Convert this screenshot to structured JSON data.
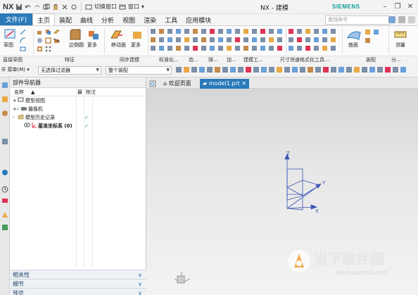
{
  "app": {
    "logo": "NX",
    "window_title": "NX - 建模",
    "brand": "SIEMENS"
  },
  "quick_access": {
    "switch_window": "切换窗口",
    "window": "窗口"
  },
  "search": {
    "placeholder": "查找命令"
  },
  "menu": {
    "file": "文件(F)",
    "tabs": [
      "主页",
      "装配",
      "曲线",
      "分析",
      "视图",
      "渲染",
      "工具",
      "应用模块"
    ],
    "active_tab": "主页"
  },
  "ribbon": {
    "sketch": "草图",
    "edge_blend": "边倒圆",
    "more": "更多",
    "move_face": "移动面",
    "more2": "更多",
    "surface": "曲面",
    "measure": "测量",
    "group_labels": [
      "直接草图",
      "特征",
      "同步建模",
      "标准化...",
      "齿...",
      "弹...",
      "加...",
      "建模工...",
      "尺寸快速格式化工具...",
      "装配",
      "分..."
    ]
  },
  "command_bar": {
    "menu": "菜单(M)",
    "filter": "无选择过滤器",
    "scope": "整个装配"
  },
  "navigator": {
    "title": "部件导航器",
    "col_name": "名称",
    "col_latest": "最",
    "col_attach": "附注",
    "rows": [
      {
        "label": "模型视图",
        "prefix": "+",
        "check": ""
      },
      {
        "label": "摄像机",
        "prefix": "+",
        "check": ""
      },
      {
        "label": "模型历史记录",
        "prefix": "-",
        "check": "✓"
      },
      {
        "label": "基准坐标系 (0)",
        "prefix": "",
        "check": "✓"
      }
    ],
    "footer": [
      "相关性",
      "细节",
      "预览"
    ]
  },
  "doc_tabs": {
    "welcome": "欢迎页面",
    "model": "model1.prt"
  },
  "axes": {
    "x": "X",
    "y": "Y",
    "z": "Z"
  },
  "watermark": {
    "name": "当下软件园",
    "url": "www.downxia.com"
  },
  "colors": {
    "accent": "#2a7ab9",
    "siemens": "#0f9a9a",
    "axis": "#3a52b5"
  }
}
